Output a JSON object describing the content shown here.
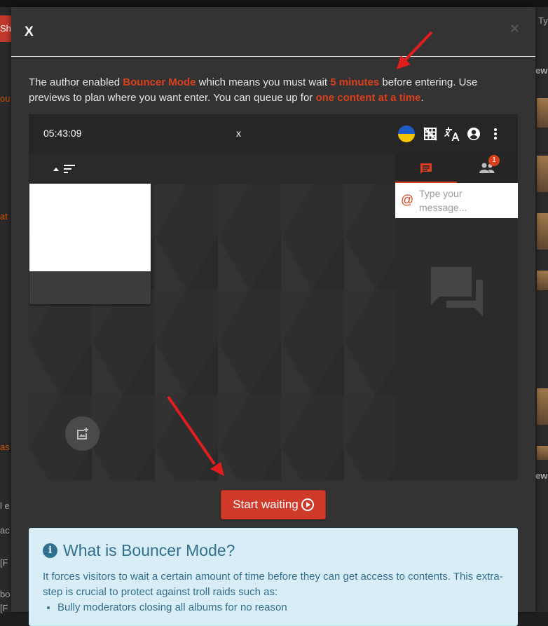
{
  "background": {
    "left_tab": "Sh",
    "right_frag_top": "Ty",
    "right_frag_new1": "ew",
    "right_frag_new2": "ew",
    "left_frags": [
      "ou",
      "at",
      "as",
      "l e",
      "ac",
      "[F",
      "bo",
      "[F"
    ]
  },
  "modal": {
    "title": "X",
    "close_glyph": "×",
    "intro": {
      "part1": "The author enabled ",
      "bouncer_mode": "Bouncer Mode",
      "part2": " which means you must wait ",
      "wait_time": "5 minutes",
      "part3": " before entering. Use previews to plan where you want enter. You can queue up for ",
      "queue_limit": "one content at a time",
      "part4": "."
    },
    "preview": {
      "clock": "05:43:09",
      "close_x": "x",
      "icons": [
        "ukraine-flag-icon",
        "grid-off-icon",
        "translate-icon",
        "account-circle-icon",
        "more-vert-icon"
      ],
      "sort_icon": "sort-icon",
      "users_badge": "1",
      "message_placeholder": "Type your message...",
      "at_symbol": "@"
    },
    "start_button": "Start waiting",
    "info": {
      "title": "What is Bouncer Mode?",
      "text": "It forces visitors to wait a certain amount of time before they can get access to contents. This extra-step is crucial to protect against troll raids such as:",
      "list": [
        "Bully moderators closing all albums for no reason"
      ]
    }
  },
  "colors": {
    "accent": "#d9411e",
    "modal_bg": "#333333",
    "info_bg": "#d9edf7",
    "info_text": "#31708f",
    "button": "#cf3a2a"
  }
}
